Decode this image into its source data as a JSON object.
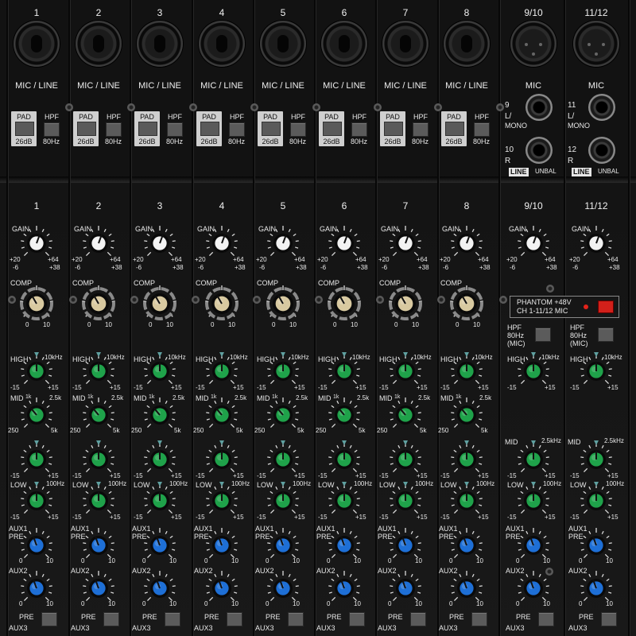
{
  "channels": [
    {
      "id": "1",
      "top": "1",
      "input": "MIC / LINE",
      "type": "mono"
    },
    {
      "id": "2",
      "top": "2",
      "input": "MIC / LINE",
      "type": "mono"
    },
    {
      "id": "3",
      "top": "3",
      "input": "MIC / LINE",
      "type": "mono"
    },
    {
      "id": "4",
      "top": "4",
      "input": "MIC / LINE",
      "type": "mono"
    },
    {
      "id": "5",
      "top": "5",
      "input": "MIC / LINE",
      "type": "mono"
    },
    {
      "id": "6",
      "top": "6",
      "input": "MIC / LINE",
      "type": "mono"
    },
    {
      "id": "7",
      "top": "7",
      "input": "MIC / LINE",
      "type": "mono"
    },
    {
      "id": "8",
      "top": "8",
      "input": "MIC / LINE",
      "type": "mono"
    },
    {
      "id": "9/10",
      "top": "9/10",
      "input": "MIC",
      "type": "stereo",
      "jack_a": "9",
      "jack_a_sub": "L/",
      "jack_a_mono": "MONO",
      "jack_b": "10",
      "jack_b_sub": "R"
    },
    {
      "id": "11/12",
      "top": "11/12",
      "input": "MIC",
      "type": "stereo",
      "jack_a": "11",
      "jack_a_sub": "L/",
      "jack_a_mono": "MONO",
      "jack_b": "12",
      "jack_b_sub": "R"
    }
  ],
  "labels": {
    "pad": "PAD",
    "pad_value": "26dB",
    "hpf": "HPF",
    "hpf_value": "80Hz",
    "gain": "GAIN",
    "gain_l1": "+20",
    "gain_l2": "-6",
    "gain_r1": "+64",
    "gain_r2": "+38",
    "comp": "COMP",
    "comp_min": "0",
    "comp_max": "10",
    "high": "HIGH",
    "high_freq": "10kHz",
    "minus15": "-15",
    "plus15": "+15",
    "mid": "MID",
    "mid_1k": "1k",
    "mid_25k": "2.5k",
    "mid_250": "250",
    "mid_5k": "5k",
    "mid_stereo": "MID",
    "mid_stereo_freq": "2.5kHz",
    "low": "LOW",
    "low_freq": "100Hz",
    "aux1": "AUX1",
    "aux2": "AUX2",
    "aux3": "AUX3",
    "pre": "PRE",
    "zero": "0",
    "ten": "10",
    "line": "LINE",
    "unbal": "UNBAL",
    "phantom_l1": "PHANTOM +48V",
    "phantom_l2": "CH 1-11/12 MIC",
    "hpf_mic_l1": "HPF",
    "hpf_mic_l2": "80Hz",
    "hpf_mic_l3": "(MIC)"
  },
  "colors": {
    "eq": "#1fa24a",
    "aux": "#1e6fd6",
    "comp": "#d8c9a0",
    "gain": "#f2f2f2",
    "phantom": "#d2201a"
  }
}
